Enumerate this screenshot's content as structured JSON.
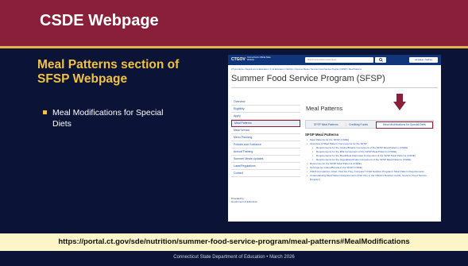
{
  "slide": {
    "title": "CSDE Webpage",
    "heading": "Meal Patterns section of SFSP Webpage",
    "bullet": "Meal Modifications for Special Diets",
    "url": "https://portal.ct.gov/sde/nutrition/summer-food-service-program/meal-patterns#MealModifications",
    "footer": "Connecticut State Department of Education • March 2026"
  },
  "colors": {
    "title_bar": "#8a1f3a",
    "background": "#0b1436",
    "heading": "#f0c243",
    "url_bar": "#fbf5c8",
    "highlight": "#8a1f3a"
  },
  "screenshot": {
    "header": {
      "logo": "CTGOV",
      "tagline": "Connecticut's Official State Website",
      "search_placeholder": "Search Connecticut Government",
      "search_icon": "search-icon",
      "language": "Language • Settings"
    },
    "breadcrumb": "CT.gov Home / Department of Education / K-12 Education / Nutrition / Summer Meals / Summer Food Service Program (SFSP) / Meal Patterns",
    "page_title": "Summer Food Service Program (SFSP)",
    "sidebar": [
      "Overview",
      "Eligibility",
      "Apply",
      "Meal Patterns",
      "Meal Service",
      "Menu Planning",
      "Policies and Guidance",
      "Annual Training",
      "Summer Meals Updates",
      "Laws/Regulations",
      "Contact"
    ],
    "provided_by": "Provided by:",
    "provided_link": "Department of Education",
    "section_title": "Meal Patterns",
    "tabs": [
      "SFSP Meal Patterns",
      "|",
      "Crediting Foods",
      "Meal Modifications for Special Diets"
    ],
    "subheading": "SFSP Meal Patterns",
    "items": [
      "Meal Patterns for the SFSP (CSDE)",
      "Overview of Meal Pattern Components for the SFSP",
      "Requirements for the Grains/Breads Component of the SFSP Meal Patterns (CSDE)",
      "Requirements for the Milk Component of the SFSP Meal Patterns (CSDE)",
      "Requirements for the Meat/Meat Alternates Component of the SFSP Meal Patterns (CSDE)",
      "Requirements for the Vegetables/Fruits Component of the SFSP Meal Patterns (CSDE)",
      "Resources for the SFSP Meal Patterns (CSDE)",
      "Servings for Grains/Breads in the SFSP (CSDE)",
      "USDA Comparison Chart: How Do They Compare? Child Nutrition Programs' Meal Pattern Requirements",
      "Understanding Meal Pattern Requirements (Part One in the USDA's Nutrition Guide: Summer Food Service Program)"
    ]
  }
}
